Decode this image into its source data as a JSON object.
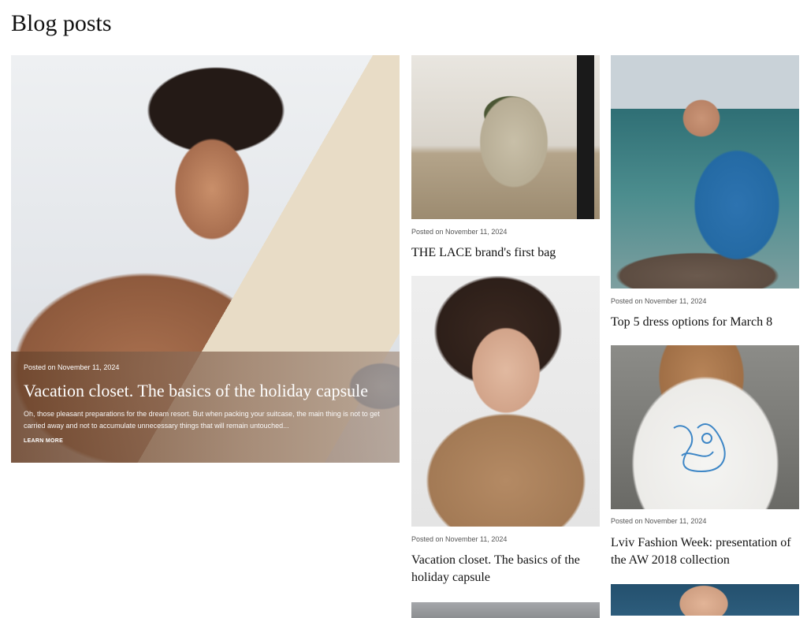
{
  "page": {
    "title": "Blog posts"
  },
  "featured": {
    "date": "Posted on November 11, 2024",
    "title": "Vacation closet. The basics of the holiday capsule",
    "excerpt": "Oh, those pleasant preparations for the dream resort. But when packing your suitcase, the main thing is not to get carried away and not to accumulate unnecessary things that will remain untouched...",
    "cta": "LEARN MORE"
  },
  "posts": [
    {
      "date": "Posted on November 11, 2024",
      "title": "THE LACE brand's first bag"
    },
    {
      "date": "Posted on November 11, 2024",
      "title": "Vacation closet. The basics of the holiday capsule"
    },
    {
      "date": "Posted on November 11, 2024",
      "title": "Top 5 dress options for March 8"
    },
    {
      "date": "Posted on November 11, 2024",
      "title": "Lviv Fashion Week: presentation of the AW 2018 collection"
    }
  ]
}
